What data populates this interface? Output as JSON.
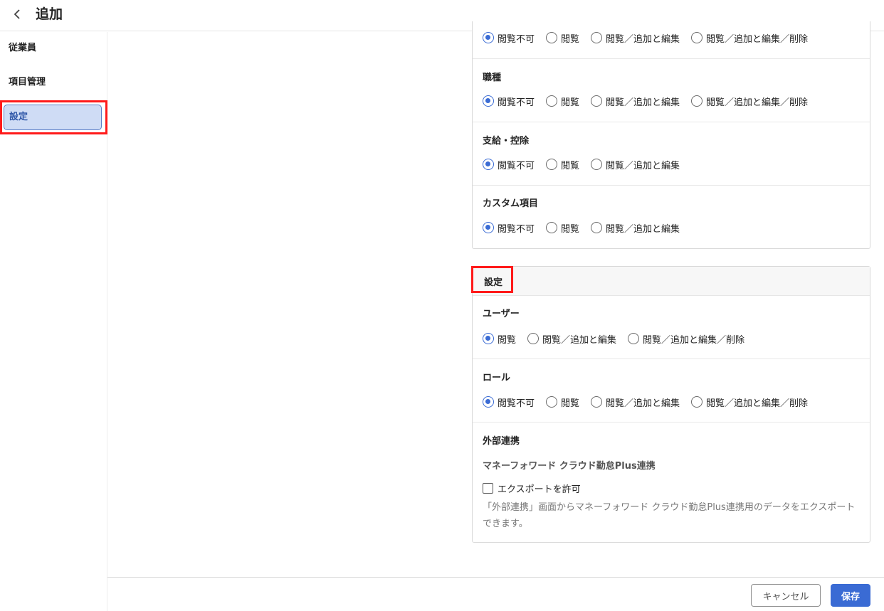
{
  "header": {
    "title": "追加"
  },
  "sidebar": {
    "items": [
      {
        "label": "従業員"
      },
      {
        "label": "項目管理"
      },
      {
        "label": "設定"
      }
    ]
  },
  "permissions_card": {
    "sections": [
      {
        "label": "",
        "options": [
          "閲覧不可",
          "閲覧",
          "閲覧／追加と編集",
          "閲覧／追加と編集／削除"
        ],
        "selected": 0
      },
      {
        "label": "職種",
        "options": [
          "閲覧不可",
          "閲覧",
          "閲覧／追加と編集",
          "閲覧／追加と編集／削除"
        ],
        "selected": 0
      },
      {
        "label": "支給・控除",
        "options": [
          "閲覧不可",
          "閲覧",
          "閲覧／追加と編集"
        ],
        "selected": 0
      },
      {
        "label": "カスタム項目",
        "options": [
          "閲覧不可",
          "閲覧",
          "閲覧／追加と編集"
        ],
        "selected": 0
      }
    ]
  },
  "settings_card": {
    "title": "設定",
    "user": {
      "label": "ユーザー",
      "options": [
        "閲覧",
        "閲覧／追加と編集",
        "閲覧／追加と編集／削除"
      ],
      "selected": 0
    },
    "role": {
      "label": "ロール",
      "options": [
        "閲覧不可",
        "閲覧",
        "閲覧／追加と編集",
        "閲覧／追加と編集／削除"
      ],
      "selected": 0
    },
    "integration": {
      "label": "外部連携",
      "sub_label": "マネーフォワード クラウド勤怠Plus連携",
      "checkbox_label": "エクスポートを許可",
      "checked": false,
      "help": "「外部連携」画面からマネーフォワード クラウド勤怠Plus連携用のデータをエクスポートできます。"
    }
  },
  "footer": {
    "cancel_label": "キャンセル",
    "save_label": "保存"
  },
  "colors": {
    "accent": "#3a6bd4",
    "highlight_frame": "#ff1a1a",
    "active_nav_bg": "#cfdcf5"
  }
}
